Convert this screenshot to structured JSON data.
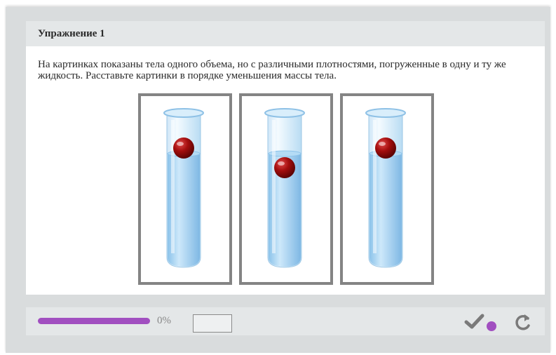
{
  "exercise": {
    "title": "Упражнение 1",
    "instruction": "На картинках показаны тела одного объема, но с различными плотностями, погруженные в одну и ту же жидкость. Расставьте картинки в порядке уменьшения массы тела.",
    "cards": [
      {
        "image": "test-tube-ball-floating-at-surface",
        "ball_position": "at-surface"
      },
      {
        "image": "test-tube-ball-submerged",
        "ball_position": "below-surface"
      },
      {
        "image": "test-tube-ball-floating-at-surface",
        "ball_position": "at-surface"
      }
    ]
  },
  "footer": {
    "progress_percent": 0,
    "progress_label": "0%",
    "answer_value": "",
    "check_icon": "check-icon",
    "reset_icon": "reset-icon"
  },
  "colors": {
    "frame": "#d9dcdd",
    "header": "#e4e7e8",
    "card_border": "#848484",
    "progress": "#a14fc0",
    "ball": "#a30d0d",
    "liquid": "#a8d2f0"
  }
}
